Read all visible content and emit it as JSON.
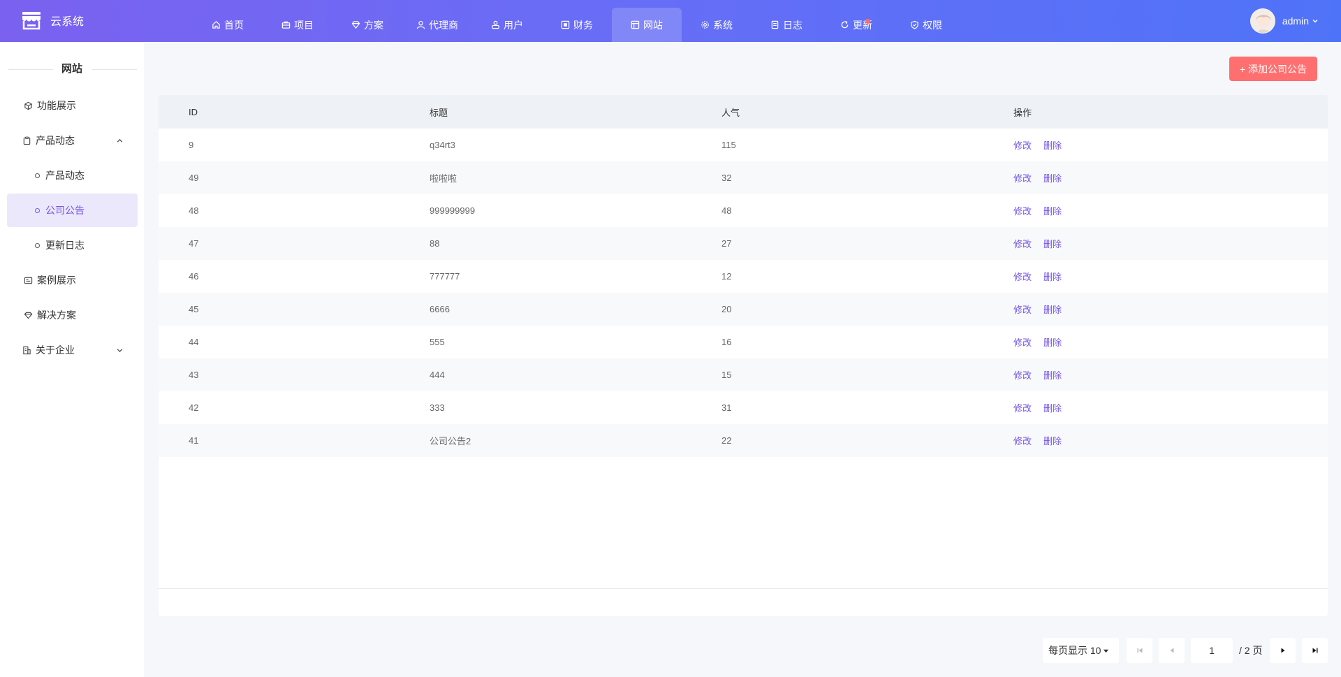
{
  "app": {
    "title": "云系统"
  },
  "nav": [
    {
      "label": "首页",
      "icon": "home-icon"
    },
    {
      "label": "项目",
      "icon": "briefcase-icon"
    },
    {
      "label": "方案",
      "icon": "diamond-icon"
    },
    {
      "label": "代理商",
      "icon": "user-tie-icon"
    },
    {
      "label": "用户",
      "icon": "users-icon"
    },
    {
      "label": "财务",
      "icon": "finance-icon"
    },
    {
      "label": "网站",
      "icon": "layout-icon",
      "active": true
    },
    {
      "label": "系统",
      "icon": "gear-icon"
    },
    {
      "label": "日志",
      "icon": "log-icon"
    },
    {
      "label": "更新",
      "icon": "refresh-icon",
      "badge": true
    },
    {
      "label": "权限",
      "icon": "shield-icon"
    }
  ],
  "user": {
    "name": "admin"
  },
  "sidebar": {
    "title": "网站",
    "items": [
      {
        "label": "功能展示"
      },
      {
        "label": "产品动态"
      },
      {
        "label": "产品动态"
      },
      {
        "label": "公司公告"
      },
      {
        "label": "更新日志"
      },
      {
        "label": "案例展示"
      },
      {
        "label": "解决方案"
      },
      {
        "label": "关于企业"
      }
    ]
  },
  "toolbar": {
    "add_label": "+ 添加公司公告"
  },
  "table": {
    "headers": [
      "ID",
      "标题",
      "人气",
      "操作"
    ],
    "edit_label": "修改",
    "delete_label": "删除",
    "rows": [
      {
        "id": "9",
        "title": "q34rt3",
        "views": "115"
      },
      {
        "id": "49",
        "title": "啦啦啦",
        "views": "32"
      },
      {
        "id": "48",
        "title": "999999999",
        "views": "48"
      },
      {
        "id": "47",
        "title": "88",
        "views": "27"
      },
      {
        "id": "46",
        "title": "777777",
        "views": "12"
      },
      {
        "id": "45",
        "title": "6666",
        "views": "20"
      },
      {
        "id": "44",
        "title": "555",
        "views": "16"
      },
      {
        "id": "43",
        "title": "444",
        "views": "15"
      },
      {
        "id": "42",
        "title": "333",
        "views": "31"
      },
      {
        "id": "41",
        "title": "公司公告2",
        "views": "22"
      }
    ]
  },
  "pagination": {
    "page_size_label": "每页显示 10",
    "current_page": "1",
    "total_label": "/ 2 页"
  },
  "colors": {
    "accent": "#7355e8",
    "add_button": "#ff6f6f",
    "badge": "#ff6b6b"
  }
}
